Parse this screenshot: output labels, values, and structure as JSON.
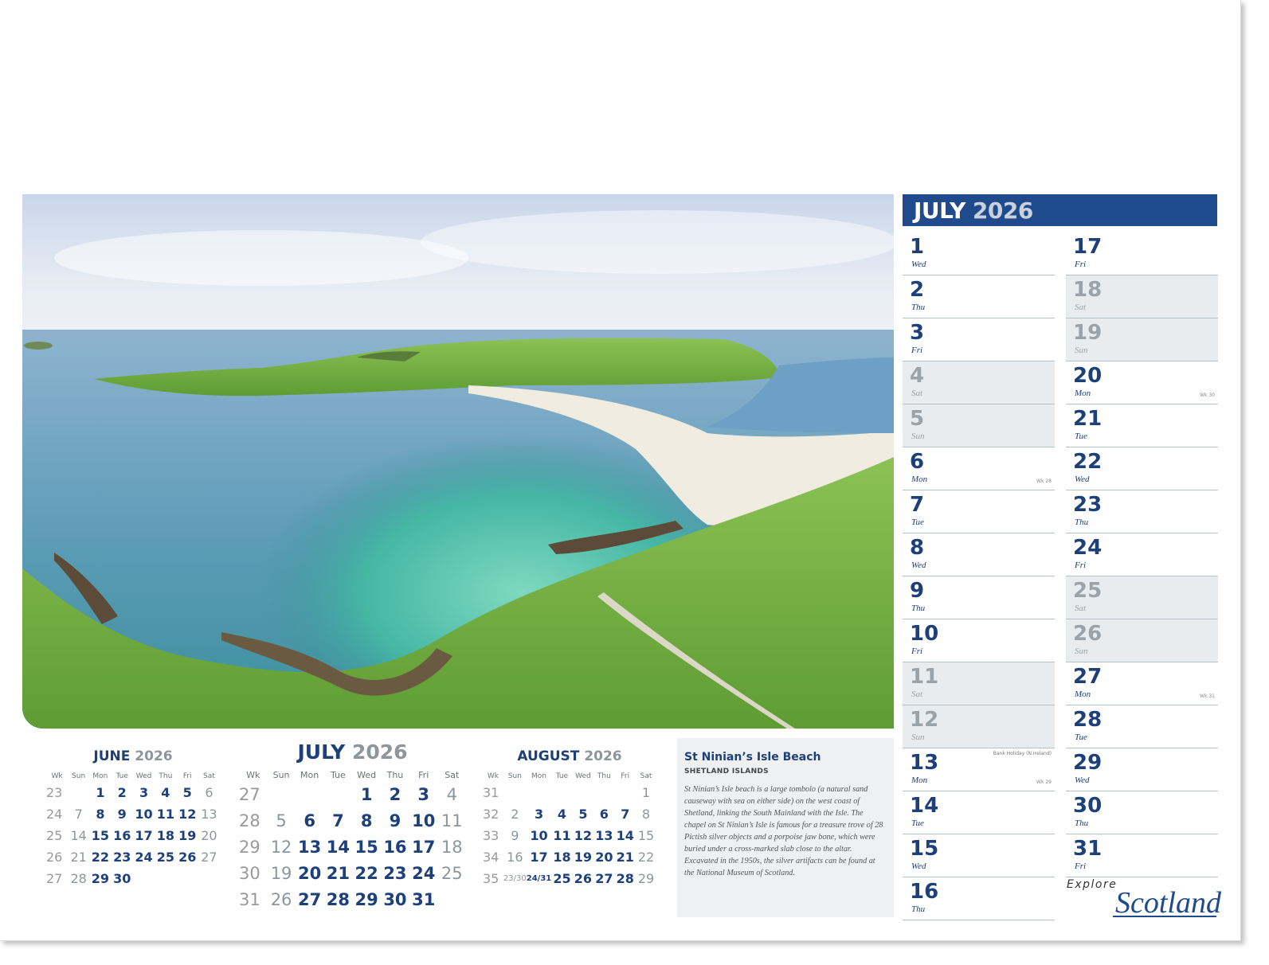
{
  "header": {
    "month": "JULY",
    "year": "2026"
  },
  "days_left": [
    {
      "num": "1",
      "name": "Wed"
    },
    {
      "num": "2",
      "name": "Thu"
    },
    {
      "num": "3",
      "name": "Fri"
    },
    {
      "num": "4",
      "name": "Sat",
      "weekend": true
    },
    {
      "num": "5",
      "name": "Sun",
      "weekend": true
    },
    {
      "num": "6",
      "name": "Mon",
      "wk": "Wk 28"
    },
    {
      "num": "7",
      "name": "Tue"
    },
    {
      "num": "8",
      "name": "Wed"
    },
    {
      "num": "9",
      "name": "Thu"
    },
    {
      "num": "10",
      "name": "Fri"
    },
    {
      "num": "11",
      "name": "Sat",
      "weekend": true
    },
    {
      "num": "12",
      "name": "Sun",
      "weekend": true
    },
    {
      "num": "13",
      "name": "Mon",
      "wk": "Wk 29",
      "holiday": "Bank Holiday (N.Ireland)"
    },
    {
      "num": "14",
      "name": "Tue"
    },
    {
      "num": "15",
      "name": "Wed"
    },
    {
      "num": "16",
      "name": "Thu"
    }
  ],
  "days_right": [
    {
      "num": "17",
      "name": "Fri"
    },
    {
      "num": "18",
      "name": "Sat",
      "weekend": true
    },
    {
      "num": "19",
      "name": "Sun",
      "weekend": true
    },
    {
      "num": "20",
      "name": "Mon",
      "wk": "Wk 30"
    },
    {
      "num": "21",
      "name": "Tue"
    },
    {
      "num": "22",
      "name": "Wed"
    },
    {
      "num": "23",
      "name": "Thu"
    },
    {
      "num": "24",
      "name": "Fri"
    },
    {
      "num": "25",
      "name": "Sat",
      "weekend": true
    },
    {
      "num": "26",
      "name": "Sun",
      "weekend": true
    },
    {
      "num": "27",
      "name": "Mon",
      "wk": "Wk 31"
    },
    {
      "num": "28",
      "name": "Tue"
    },
    {
      "num": "29",
      "name": "Wed"
    },
    {
      "num": "30",
      "name": "Thu"
    },
    {
      "num": "31",
      "name": "Fri"
    }
  ],
  "mini_calendars": [
    {
      "month": "JUNE",
      "year": "2026",
      "headers": [
        "Wk",
        "Sun",
        "Mon",
        "Tue",
        "Wed",
        "Thu",
        "Fri",
        "Sat"
      ],
      "rows": [
        [
          "23",
          "",
          "1",
          "2",
          "3",
          "4",
          "5",
          "6"
        ],
        [
          "24",
          "7",
          "8",
          "9",
          "10",
          "11",
          "12",
          "13"
        ],
        [
          "25",
          "14",
          "15",
          "16",
          "17",
          "18",
          "19",
          "20"
        ],
        [
          "26",
          "21",
          "22",
          "23",
          "24",
          "25",
          "26",
          "27"
        ],
        [
          "27",
          "28",
          "29",
          "30",
          "",
          "",
          "",
          ""
        ]
      ]
    },
    {
      "month": "JULY",
      "year": "2026",
      "headers": [
        "Wk",
        "Sun",
        "Mon",
        "Tue",
        "Wed",
        "Thu",
        "Fri",
        "Sat"
      ],
      "rows": [
        [
          "27",
          "",
          "",
          "",
          "1",
          "2",
          "3",
          "4"
        ],
        [
          "28",
          "5",
          "6",
          "7",
          "8",
          "9",
          "10",
          "11"
        ],
        [
          "29",
          "12",
          "13",
          "14",
          "15",
          "16",
          "17",
          "18"
        ],
        [
          "30",
          "19",
          "20",
          "21",
          "22",
          "23",
          "24",
          "25"
        ],
        [
          "31",
          "26",
          "27",
          "28",
          "29",
          "30",
          "31",
          ""
        ]
      ]
    },
    {
      "month": "AUGUST",
      "year": "2026",
      "headers": [
        "Wk",
        "Sun",
        "Mon",
        "Tue",
        "Wed",
        "Thu",
        "Fri",
        "Sat"
      ],
      "rows": [
        [
          "31",
          "",
          "",
          "",
          "",
          "",
          "",
          "1"
        ],
        [
          "32",
          "2",
          "3",
          "4",
          "5",
          "6",
          "7",
          "8"
        ],
        [
          "33",
          "9",
          "10",
          "11",
          "12",
          "13",
          "14",
          "15"
        ],
        [
          "34",
          "16",
          "17",
          "18",
          "19",
          "20",
          "21",
          "22"
        ],
        [
          "35",
          "23/30",
          "24/31",
          "25",
          "26",
          "27",
          "28",
          "29"
        ]
      ]
    }
  ],
  "caption": {
    "title": "St Ninian’s Isle Beach",
    "subtitle": "SHETLAND ISLANDS",
    "body": "St Ninian’s Isle beach is a large tombolo (a natural sand causeway with sea on either side) on the west coast of Shetland, linking the South Mainland with the Isle. The chapel on St Ninian’s Isle is famous for a treasure trove of 28 Pictish silver objects and a porpoise jaw bone, which were buried under a cross-marked slab close to the altar. Excavated in the 1950s, the silver artifacts can be found at the National Museum of Scotland."
  },
  "brand": {
    "explore": "Explore",
    "scotland": "Scotland"
  },
  "colors": {
    "primary": "#1f4a8c",
    "weekend_bg": "#e9ecee",
    "grey_text": "#9ba2a8"
  }
}
